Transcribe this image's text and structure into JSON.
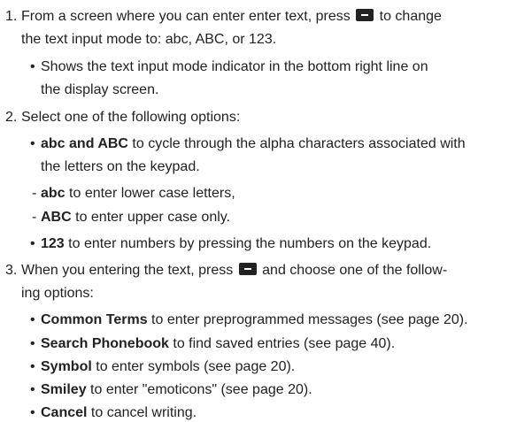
{
  "steps": [
    {
      "number": "1.",
      "lines": [
        {
          "pre": "From a screen where you can enter enter text, press",
          "post": "to change"
        },
        {
          "text": "the text input mode to: abc, ABC, or 123."
        }
      ],
      "bullets": [
        {
          "text1": "Shows the text input mode indicator in the bottom right line on",
          "text2": "the display screen."
        }
      ]
    },
    {
      "number": "2.",
      "line": "Select one of the following options:",
      "bullets": [
        {
          "bold": "abc and ABC",
          "text1": " to cycle through the alpha characters associated with",
          "text2": "the letters on the keypad."
        },
        {
          "bold": "123",
          "text1": " to enter numbers by pressing the numbers on the keypad."
        }
      ],
      "dashes": [
        {
          "bold": "abc",
          "text": " to enter lower case letters,"
        },
        {
          "bold": "ABC",
          "text": " to enter upper case only."
        }
      ]
    },
    {
      "number": "3.",
      "lines": [
        {
          "pre": "When you entering the text, press",
          "post": "and choose one of the follow-"
        },
        {
          "text": "ing options:"
        }
      ],
      "bullets": [
        {
          "bold": "Common Terms",
          "text1": " to enter preprogrammed messages (see page 20)."
        },
        {
          "bold": "Search Phonebook",
          "text1": " to find saved entries (see page 40)."
        },
        {
          "bold": "Symbol",
          "text1": " to enter symbols (see page 20)."
        },
        {
          "bold": "Smiley",
          "text1": " to enter \"emoticons\" (see page 20)."
        },
        {
          "bold": "Cancel",
          "text1": " to cancel writing."
        }
      ]
    }
  ],
  "bullet_glyph": "•",
  "dash_glyph": "-",
  "icons": {
    "key": "minus-softkey-icon"
  },
  "colors": {
    "text": "#222222",
    "key": "#222222"
  }
}
